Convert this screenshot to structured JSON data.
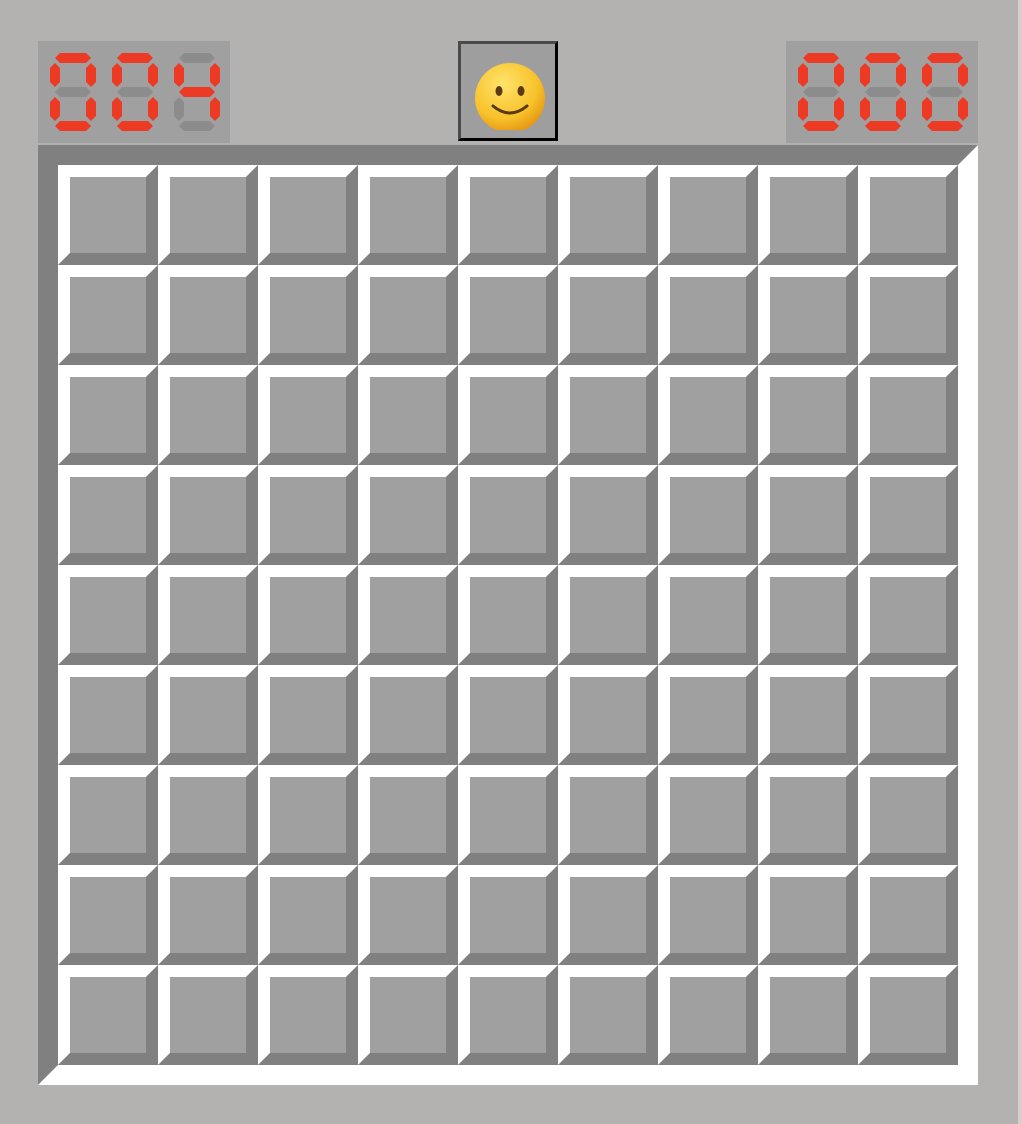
{
  "game": {
    "name": "Minesweeper",
    "rows": 9,
    "cols": 9,
    "state": "playing",
    "mines_remaining": "004",
    "elapsed_time": "000",
    "face": "smiley-face",
    "cells": "all-covered"
  },
  "colors": {
    "background": "#b3b2b0",
    "led_on": "#ec3a25",
    "led_off": "#8c8c8c",
    "counter_bg": "#a0a0a0",
    "cell_face": "#a0a0a0",
    "cell_highlight": "#ffffff",
    "cell_shadow": "#808080"
  }
}
